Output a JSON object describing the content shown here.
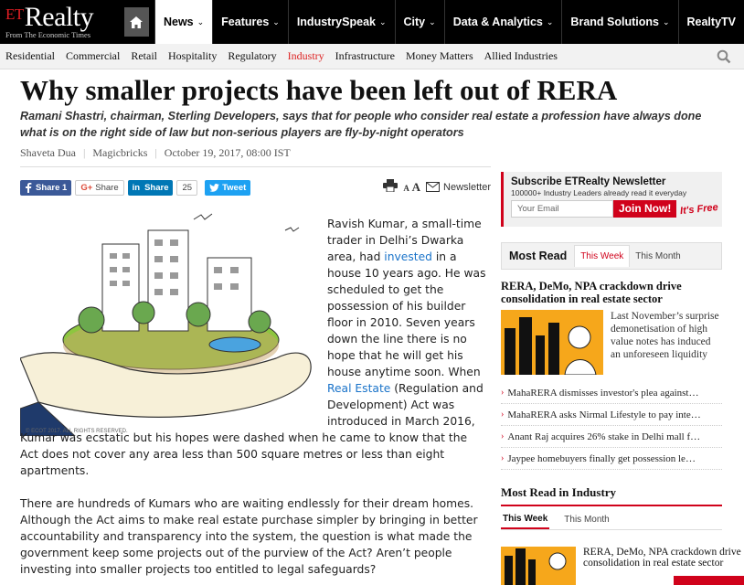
{
  "brand": {
    "et": "ET",
    "name": "Realty",
    "tagline": "From The Economic Times"
  },
  "nav": [
    {
      "label": "News",
      "chev": "⌄",
      "active": true
    },
    {
      "label": "Features",
      "chev": "⌄"
    },
    {
      "label": "IndustrySpeak",
      "chev": "⌄"
    },
    {
      "label": "City",
      "chev": "⌄"
    },
    {
      "label": "Data & Analytics",
      "chev": "⌄"
    },
    {
      "label": "Brand Solutions",
      "chev": "⌄"
    },
    {
      "label": "RealtyTV",
      "chev": ""
    }
  ],
  "subnav": [
    "Residential",
    "Commercial",
    "Retail",
    "Hospitality",
    "Regulatory",
    "Industry",
    "Infrastructure",
    "Money Matters",
    "Allied Industries"
  ],
  "article": {
    "headline": "Why smaller projects have been left out of RERA",
    "synopsis": "Ramani Shastri, chairman, Sterling Developers, says that for people who consider real estate a profession have always done what is on the right side of law but non-serious players are fly-by-night operators",
    "author": "Shaveta Dua",
    "source": "Magicbricks",
    "date": "October 19, 2017, 08:00 IST",
    "p1": {
      "a": "Ravish Kumar, a small-time trader in Delhi’s Dwarka area, had ",
      "link1": "invested",
      "b": " in a house 10 years ago. He was scheduled to get the possession of his builder floor in 2010. Seven years down the line there is no hope that he will get his house anytime soon. When ",
      "link2": "Real Estate",
      "c": " (Regulation and Development) Act was introduced in March 2016, Kumar was ecstatic but his hopes were dashed when he came to know that the Act does not cover any area less than 500 square metres or less than eight apartments."
    },
    "p2": "There are hundreds of Kumars who are waiting endlessly for their dream homes. Although the Act aims to make real estate purchase simpler by bringing in better accountability and transparency into the system, the question is what made the government keep some projects out of the purview of the Act? Aren’t people investing into smaller projects too entitled to legal safeguards?",
    "image_credit": "© ECOT 2017. ALL RIGHTS RESERVED."
  },
  "share": {
    "fb": "Share 1",
    "gplus": "Share",
    "gplus_icon": "G+",
    "li": "Share",
    "li_icon": "in",
    "count": "25",
    "tw": "Tweet",
    "font_small": "A",
    "font_big": "A",
    "newsletter": "Newsletter"
  },
  "newsletter_box": {
    "title": "Subscribe ETRealty Newsletter",
    "subtitle": "100000+ Industry Leaders already read it everyday",
    "placeholder": "Your Email",
    "button": "Join Now!",
    "free": "It's Free"
  },
  "most_read": {
    "title": "Most Read",
    "tabs": [
      "This Week",
      "This Month"
    ],
    "lead_title": "RERA, DeMo, NPA crackdown drive consolidation in real estate sector",
    "lead_desc": "Last November’s surprise demonetisation of high value notes has induced an unforeseen liquidity",
    "items": [
      "MahaRERA dismisses investor's plea against…",
      "MahaRERA asks Nirmal Lifestyle to pay inte…",
      "Anant Raj acquires 26% stake in Delhi mall f…",
      "Jaypee homebuyers finally get possession le…"
    ]
  },
  "most_read_industry": {
    "title": "Most Read in Industry",
    "tabs": [
      "This Week",
      "This Month"
    ],
    "lead_title": "RERA, DeMo, NPA crackdown drive consolidation in real estate sector"
  },
  "colors": {
    "brand_red": "#d0021b",
    "link_blue": "#1a73c9",
    "fb": "#3b5998",
    "li": "#0077b5",
    "tw": "#1da1f2"
  }
}
